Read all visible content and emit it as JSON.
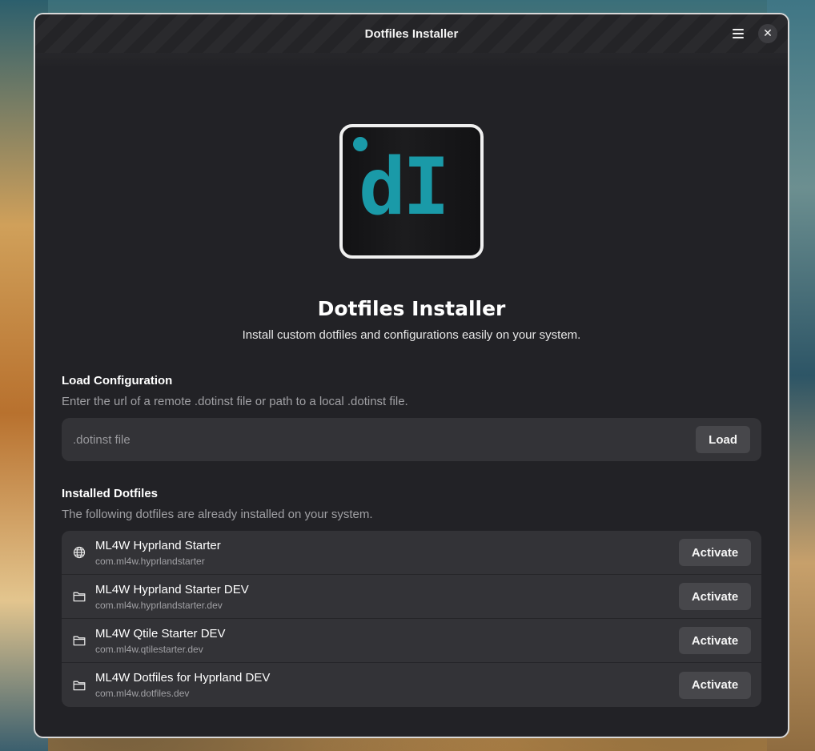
{
  "window": {
    "title": "Dotfiles Installer"
  },
  "hero": {
    "logo_text": "dI",
    "title": "Dotfiles Installer",
    "subtitle": "Install custom dotfiles and configurations easily on your system."
  },
  "load": {
    "title": "Load Configuration",
    "description": "Enter the url of a remote .dotinst file or path to a local .dotinst file.",
    "placeholder": ".dotinst file",
    "button_label": "Load"
  },
  "installed": {
    "title": "Installed Dotfiles",
    "description": "The following dotfiles are already installed on your system.",
    "items": [
      {
        "name": "ML4W Hyprland Starter",
        "id": "com.ml4w.hyprlandstarter",
        "icon": "globe-icon",
        "action": "Activate"
      },
      {
        "name": "ML4W Hyprland Starter DEV",
        "id": "com.ml4w.hyprlandstarter.dev",
        "icon": "folder-icon",
        "action": "Activate"
      },
      {
        "name": "ML4W Qtile Starter DEV",
        "id": "com.ml4w.qtilestarter.dev",
        "icon": "folder-icon",
        "action": "Activate"
      },
      {
        "name": "ML4W Dotfiles for Hyprland DEV",
        "id": "com.ml4w.dotfiles.dev",
        "icon": "folder-icon",
        "action": "Activate"
      }
    ]
  },
  "colors": {
    "accent": "#1a9aa8",
    "window_bg": "#222226",
    "card_bg": "#333337"
  }
}
